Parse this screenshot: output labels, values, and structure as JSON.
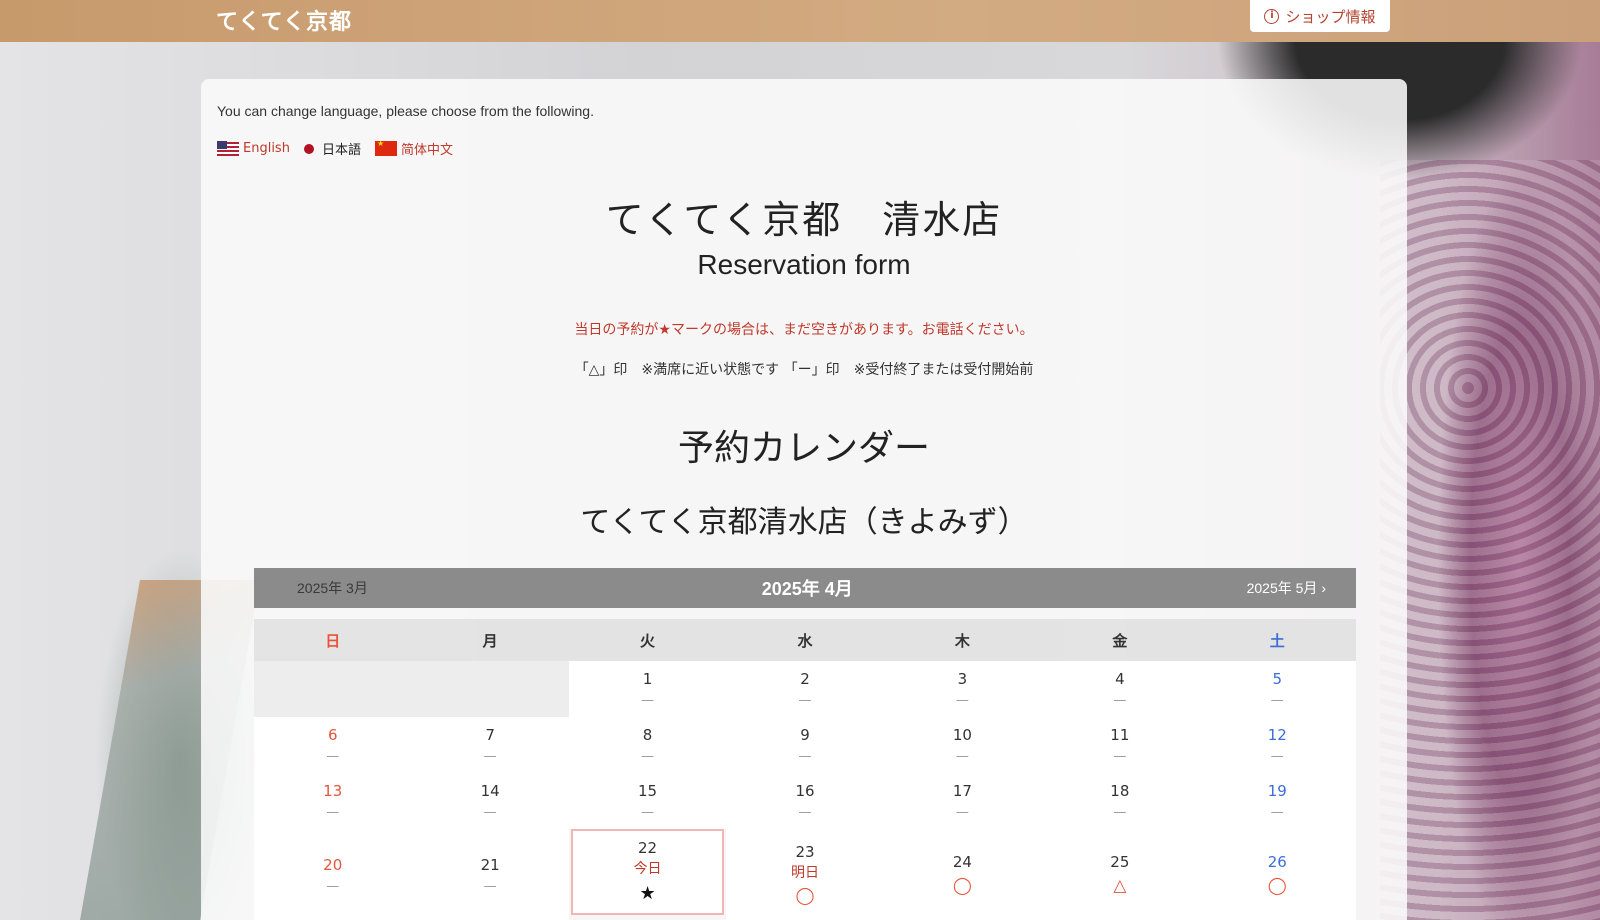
{
  "header": {
    "brand": "てくてく京都",
    "shop_info_label": "ショップ情報"
  },
  "language": {
    "note": "You can change language, please choose from the following.",
    "options": [
      {
        "label": "English",
        "flag": "us-flag"
      },
      {
        "label": "日本語",
        "flag": "jp-dot"
      },
      {
        "label": "简体中文",
        "flag": "cn-flag"
      }
    ]
  },
  "main": {
    "shop_title": "てくてく京都　清水店",
    "form_title": "Reservation form",
    "notice_red": "当日の予約が★マークの場合は、まだ空きがあります。お電話ください。",
    "notice_legend": "「△」印　※満席に近い状態です 「ー」印　※受付終了または受付開始前",
    "calendar_heading": "予約カレンダー",
    "store_heading": "てくてく京都清水店（きよみず）"
  },
  "calendar": {
    "prev_label": "2025年 3月",
    "current_label": "2025年 4月",
    "next_label": "2025年 5月",
    "next_arrow": "›",
    "weekdays": [
      "日",
      "月",
      "火",
      "水",
      "木",
      "金",
      "土"
    ],
    "weeks": [
      [
        {
          "day": "",
          "mark": ""
        },
        {
          "day": "",
          "mark": ""
        },
        {
          "day": "1",
          "mark": "—"
        },
        {
          "day": "2",
          "mark": "—"
        },
        {
          "day": "3",
          "mark": "—"
        },
        {
          "day": "4",
          "mark": "—"
        },
        {
          "day": "5",
          "mark": "—"
        }
      ],
      [
        {
          "day": "6",
          "mark": "—"
        },
        {
          "day": "7",
          "mark": "—"
        },
        {
          "day": "8",
          "mark": "—"
        },
        {
          "day": "9",
          "mark": "—"
        },
        {
          "day": "10",
          "mark": "—"
        },
        {
          "day": "11",
          "mark": "—"
        },
        {
          "day": "12",
          "mark": "—"
        }
      ],
      [
        {
          "day": "13",
          "mark": "—"
        },
        {
          "day": "14",
          "mark": "—"
        },
        {
          "day": "15",
          "mark": "—"
        },
        {
          "day": "16",
          "mark": "—"
        },
        {
          "day": "17",
          "mark": "—"
        },
        {
          "day": "18",
          "mark": "—"
        },
        {
          "day": "19",
          "mark": "—"
        }
      ],
      [
        {
          "day": "20",
          "mark": "—"
        },
        {
          "day": "21",
          "mark": "—"
        },
        {
          "day": "22",
          "sub": "今日",
          "mark": "★"
        },
        {
          "day": "23",
          "sub": "明日",
          "mark": "◯"
        },
        {
          "day": "24",
          "mark": "◯"
        },
        {
          "day": "25",
          "mark": "△"
        },
        {
          "day": "26",
          "mark": "◯"
        }
      ]
    ]
  }
}
